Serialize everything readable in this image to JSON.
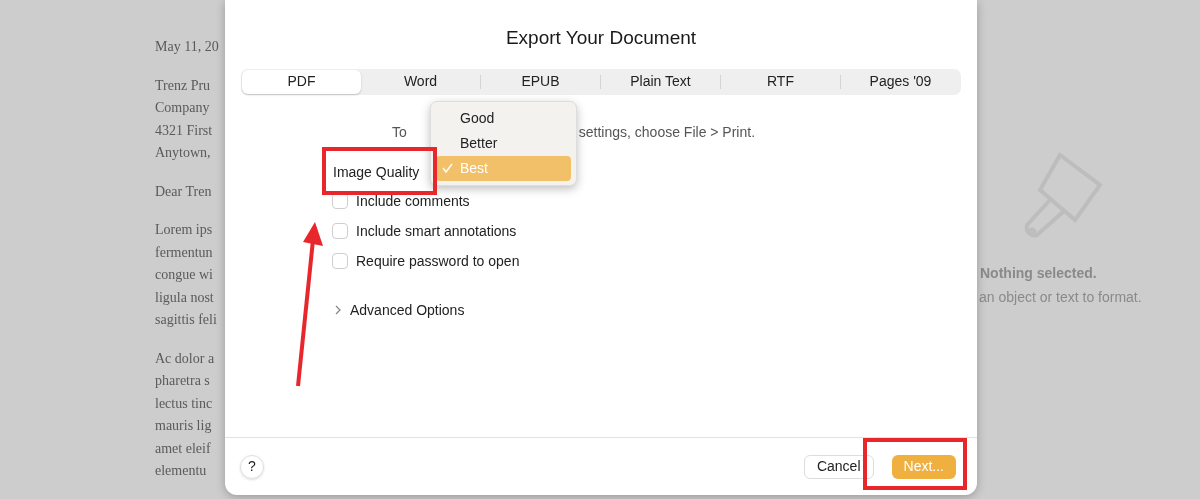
{
  "document": {
    "paragraphs": [
      [
        "May 11, 20"
      ],
      [
        "Trenz Pru",
        "Company",
        "4321 First",
        "Anytown,"
      ],
      [
        "Dear Tren"
      ],
      [
        "Lorem ips",
        "fermentun",
        "congue wi",
        "ligula nost",
        "sagittis feli"
      ],
      [
        "Ac dolor a",
        "pharetra s",
        "lectus tinc",
        "mauris lig",
        "amet eleif",
        "elementu"
      ]
    ]
  },
  "dialog": {
    "title": "Export Your Document",
    "tabs": [
      {
        "label": "PDF",
        "selected": true
      },
      {
        "label": "Word",
        "selected": false
      },
      {
        "label": "EPUB",
        "selected": false
      },
      {
        "label": "Plain Text",
        "selected": false
      },
      {
        "label": "RTF",
        "selected": false
      },
      {
        "label": "Pages '09",
        "selected": false
      }
    ],
    "info_text": [
      "To",
      "settings, choose File > Print."
    ],
    "image_quality": {
      "label": "Image Quality",
      "menu": [
        {
          "label": "Good",
          "selected": false
        },
        {
          "label": "Better",
          "selected": false
        },
        {
          "label": "Best",
          "selected": true
        }
      ]
    },
    "options": [
      {
        "label": "Include comments",
        "checked": false
      },
      {
        "label": "Include smart annotations",
        "checked": false
      },
      {
        "label": "Require password to open",
        "checked": false
      }
    ],
    "advanced": {
      "label": "Advanced Options",
      "expanded": false
    },
    "help": "?",
    "buttons": [
      {
        "label": "Cancel",
        "kind": "secondary"
      },
      {
        "label": "Next...",
        "kind": "primary"
      }
    ]
  },
  "inspector": {
    "title": "Nothing selected.",
    "hint": "an object or text to format."
  },
  "annotations": [
    {
      "kind": "box"
    },
    {
      "kind": "box"
    },
    {
      "kind": "arrow"
    }
  ]
}
